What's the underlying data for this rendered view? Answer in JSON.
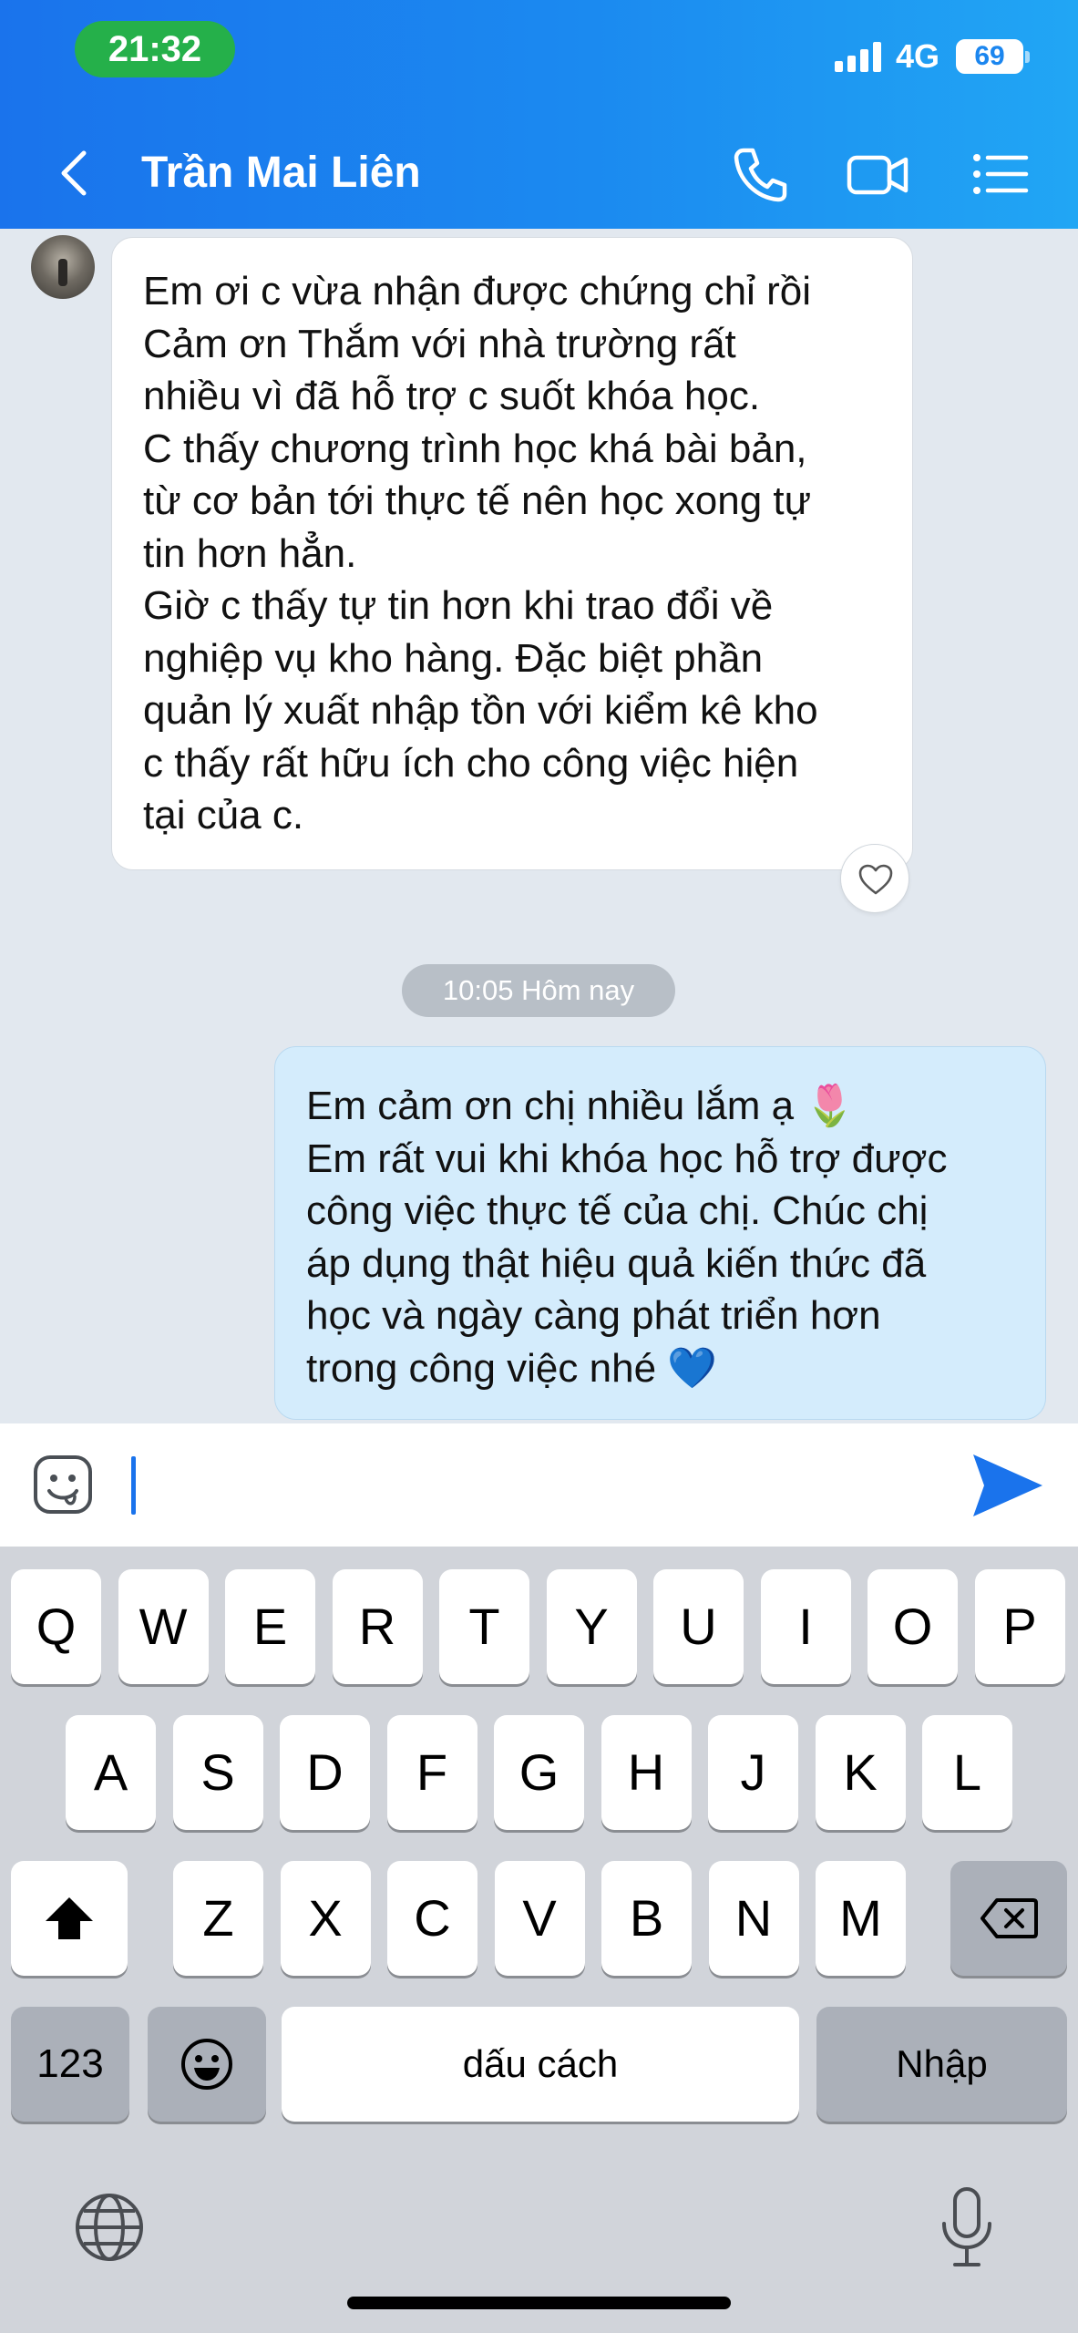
{
  "status_bar": {
    "time": "21:32",
    "network": "4G",
    "battery": "69"
  },
  "header": {
    "contact_name": "Trần Mai Liên",
    "back_icon": "chevron-left-icon",
    "call_icon": "phone-icon",
    "video_icon": "video-camera-icon",
    "menu_icon": "list-menu-icon"
  },
  "messages": [
    {
      "direction": "incoming",
      "text": "Em ơi c vừa nhận được chứng chỉ rồi\nCảm ơn Thắm với nhà trường rất\nnhiều vì đã hỗ trợ c suốt khóa học.\nC thấy chương trình học khá bài bản,\ntừ cơ bản tới thực tế nên học xong tự\ntin hơn hẳn.\nGiờ c thấy tự tin hơn khi trao đổi về\nnghiệp vụ kho hàng. Đặc biệt phần\nquản lý xuất nhập tồn với kiểm kê kho\nc thấy rất hữu ích cho công việc hiện\ntại của c.",
      "reaction_icon": "heart-icon"
    },
    {
      "direction": "outgoing",
      "text": "Em cảm ơn chị nhiều lắm ạ 🌷\nEm rất vui khi khóa học hỗ trợ được\ncông việc thực tế của chị. Chúc chị\náp dụng thật hiệu quả kiến thức đã\nhọc và ngày càng phát triển hơn\ntrong công việc nhé 💙"
    }
  ],
  "time_separator": "10:05 Hôm nay",
  "composer": {
    "emoji_icon": "sticker-icon",
    "send_icon": "send-icon",
    "value": ""
  },
  "keyboard": {
    "row1": [
      "Q",
      "W",
      "E",
      "R",
      "T",
      "Y",
      "U",
      "I",
      "O",
      "P"
    ],
    "row2": [
      "A",
      "S",
      "D",
      "F",
      "G",
      "H",
      "J",
      "K",
      "L"
    ],
    "row3": [
      "Z",
      "X",
      "C",
      "V",
      "B",
      "N",
      "M"
    ],
    "numbers_key": "123",
    "space_key": "dấu cách",
    "return_key": "Nhập",
    "shift_icon": "shift-icon",
    "delete_icon": "backspace-icon",
    "emoji_key_icon": "emoji-icon",
    "globe_icon": "globe-icon",
    "mic_icon": "microphone-icon"
  },
  "colors": {
    "accent": "#1a73ec",
    "outgoing_bubble": "#d4ecfc",
    "time_pill": "#25b04a"
  }
}
